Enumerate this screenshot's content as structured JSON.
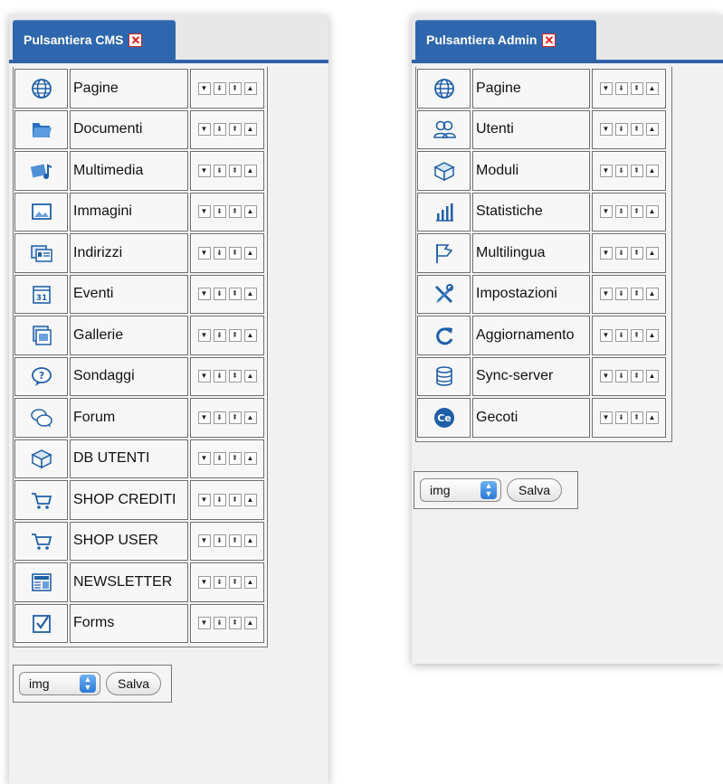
{
  "cms": {
    "tab_label": "Pulsantiera CMS",
    "close_glyph": "✕",
    "items": [
      {
        "label": "Pagine",
        "icon": "globe-icon"
      },
      {
        "label": "Documenti",
        "icon": "folder-icon"
      },
      {
        "label": "Multimedia",
        "icon": "multimedia-icon"
      },
      {
        "label": "Immagini",
        "icon": "image-icon"
      },
      {
        "label": "Indirizzi",
        "icon": "address-card-icon"
      },
      {
        "label": "Eventi",
        "icon": "calendar-icon"
      },
      {
        "label": "Gallerie",
        "icon": "gallery-icon"
      },
      {
        "label": "Sondaggi",
        "icon": "question-bubble-icon"
      },
      {
        "label": "Forum",
        "icon": "chat-bubbles-icon"
      },
      {
        "label": "DB UTENTI",
        "icon": "box-icon"
      },
      {
        "label": "SHOP CREDITI",
        "icon": "shopping-cart-icon"
      },
      {
        "label": "SHOP USER",
        "icon": "shopping-cart-icon"
      },
      {
        "label": "NEWSLETTER",
        "icon": "newspaper-icon"
      },
      {
        "label": "Forms",
        "icon": "checkbox-icon"
      }
    ],
    "select_value": "img",
    "save_label": "Salva"
  },
  "admin": {
    "tab_label": "Pulsantiera Admin",
    "close_glyph": "✕",
    "items": [
      {
        "label": "Pagine",
        "icon": "globe-icon"
      },
      {
        "label": "Utenti",
        "icon": "users-icon"
      },
      {
        "label": "Moduli",
        "icon": "box-icon"
      },
      {
        "label": "Statistiche",
        "icon": "bar-chart-icon"
      },
      {
        "label": "Multilingua",
        "icon": "flag-icon"
      },
      {
        "label": "Impostazioni",
        "icon": "tools-icon"
      },
      {
        "label": "Aggiornamento",
        "icon": "refresh-icon"
      },
      {
        "label": "Sync-server",
        "icon": "database-icon"
      },
      {
        "label": "Gecoti",
        "icon": "ce-logo-icon"
      }
    ],
    "select_value": "img",
    "save_label": "Salva"
  },
  "controls": {
    "down_glyph": "▼",
    "bottom_glyph": "⇟",
    "top_glyph": "⇞",
    "up_glyph": "▲"
  },
  "colors": {
    "tab_blue": "#2e67ad",
    "icon_blue": "#1f5fa8",
    "close_red": "#d41a1a"
  }
}
